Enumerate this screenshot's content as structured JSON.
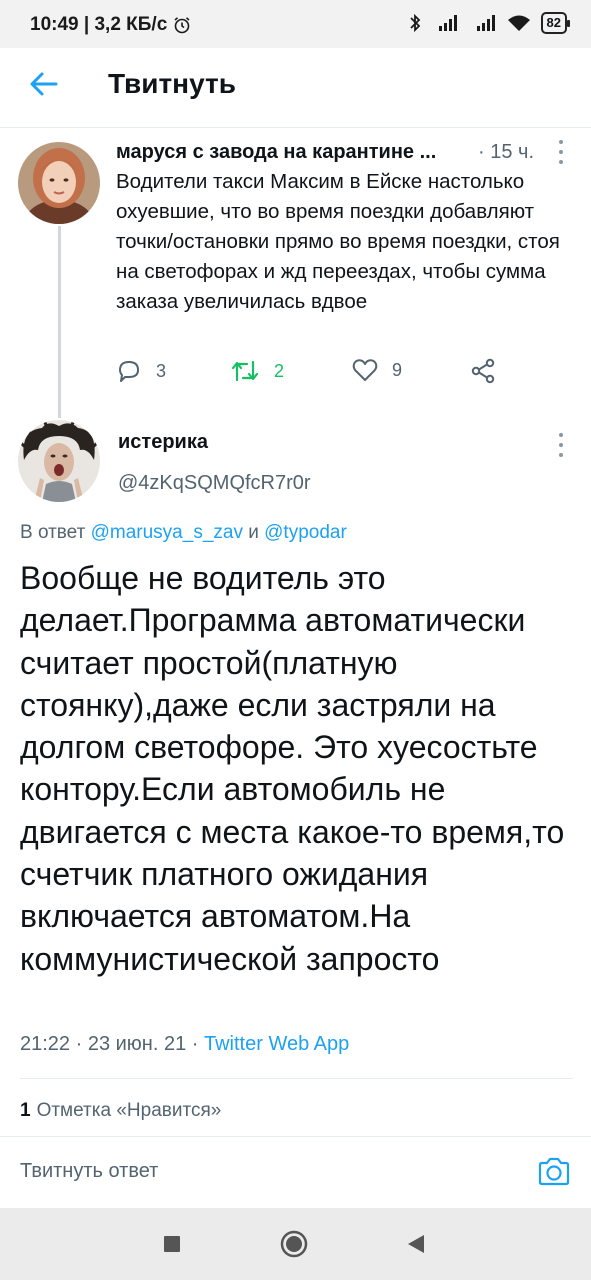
{
  "status_bar": {
    "time_speed": "10:49 | 3,2 КБ/с",
    "battery": "82"
  },
  "header": {
    "title": "Твитнуть"
  },
  "parent_tweet": {
    "author_name": "маруся с завода на карантине ...",
    "time": "· 15 ч.",
    "text": "Водители такси Максим в Ейске настолько охуевшие, что во время поездки добавляют точки/остановки прямо во время поездки, стоя на светофорах и жд переездах, чтобы сумма заказа увеличилась вдвое",
    "replies": "3",
    "retweets": "2",
    "likes": "9"
  },
  "main_tweet": {
    "author_name": "истерика",
    "handle": "@4zKqSQMQfcR7r0r",
    "reply_prefix": "В ответ ",
    "reply_user_1": "@marusya_s_zav",
    "reply_and": " и ",
    "reply_user_2": "@typodar",
    "text": "Вообще не водитель это делает.Программа автоматически считает простой(платную стоянку),даже если застряли на долгом светофоре. Это хуесостьте контору.Если автомобиль не двигается с места какое-то время,то счетчик платного ожидания включается автоматом.На коммунистической запросто",
    "timestamp": "21:22 · 23 июн. 21 · ",
    "source": "Twitter Web App",
    "likes_count": "1",
    "likes_label": "Отметка «Нравится»"
  },
  "reply_composer": {
    "placeholder": "Твитнуть ответ"
  },
  "colors": {
    "accent": "#1da1f2",
    "retweet": "#17bf63",
    "secondary_text": "#536471"
  }
}
